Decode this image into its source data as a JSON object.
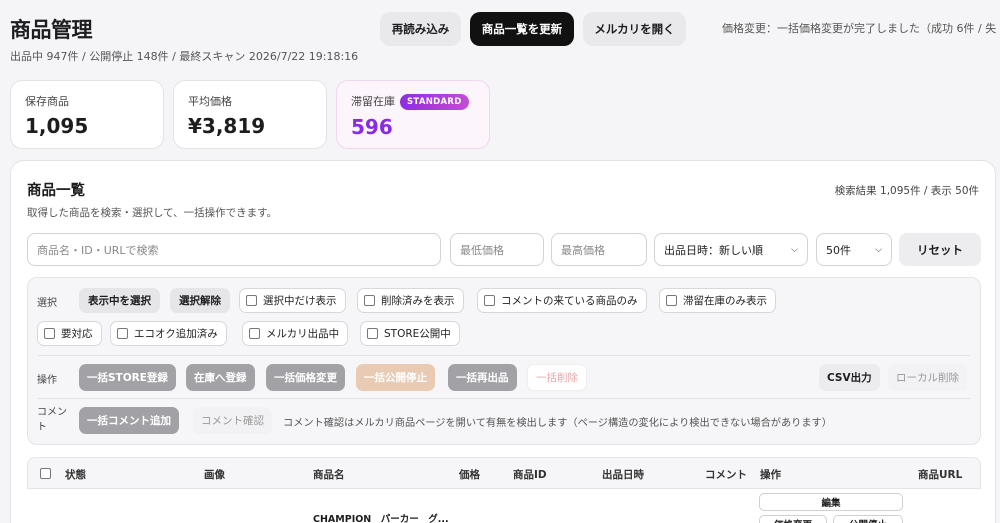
{
  "header": {
    "title": "商品管理",
    "subtitle": "出品中 947件 / 公開停止 148件 / 最終スキャン 2026/7/22 19:18:16",
    "buttons": {
      "reload": "再読み込み",
      "refresh_list": "商品一覧を更新",
      "open_mercari": "メルカリを開く"
    },
    "status_message": "価格変更：一括価格変更が完了しました（成功 6件 / 失"
  },
  "stats": [
    {
      "label": "保存商品",
      "value": "1,095"
    },
    {
      "label": "平均価格",
      "value": "¥3,819"
    },
    {
      "label": "滞留在庫",
      "value": "596",
      "badge": "STANDARD"
    }
  ],
  "panel": {
    "title": "商品一覧",
    "description": "取得した商品を検索・選択して、一括操作できます。",
    "result_count": "検索結果 1,095件 / 表示 50件",
    "search_placeholder": "商品名・ID・URLで検索",
    "min_price_placeholder": "最低価格",
    "max_price_placeholder": "最高価格",
    "sort_selected": "出品日時：新しい順",
    "page_size_selected": "50件",
    "reset": "リセット"
  },
  "filters": {
    "select_label": "選択",
    "select_all": "表示中を選択",
    "deselect": "選択解除",
    "checkboxes": [
      "選択中だけ表示",
      "削除済みを表示",
      "コメントの来ている商品のみ",
      "滞留在庫のみ表示",
      "要対応",
      "エコオク追加済み",
      "メルカリ出品中",
      "STORE公開中"
    ]
  },
  "operations": {
    "label": "操作",
    "store_register": "一括STORE登録",
    "stock_register": "在庫へ登録",
    "price_change": "一括価格変更",
    "suspend": "一括公開停止",
    "relist": "一括再出品",
    "delete": "一括削除",
    "csv": "CSV出力",
    "local_delete": "ローカル削除"
  },
  "comments": {
    "label": "コメント",
    "bulk_add": "一括コメント追加",
    "check": "コメント確認",
    "note": "コメント確認はメルカリ商品ページを開いて有無を検出します（ページ構造の変化により検出できない場合があります）"
  },
  "table": {
    "columns": [
      "状態",
      "画像",
      "商品名",
      "価格",
      "商品ID",
      "出品日時",
      "コメント",
      "操作",
      "商品URL"
    ],
    "first_row": {
      "name": "CHAMPION　パーカー　グ...",
      "edit": "編集",
      "price_change": "価格変更",
      "suspend": "公開停止"
    }
  },
  "colors": {
    "accent_purple": "#8a2be2",
    "dark_button": "#111111"
  }
}
